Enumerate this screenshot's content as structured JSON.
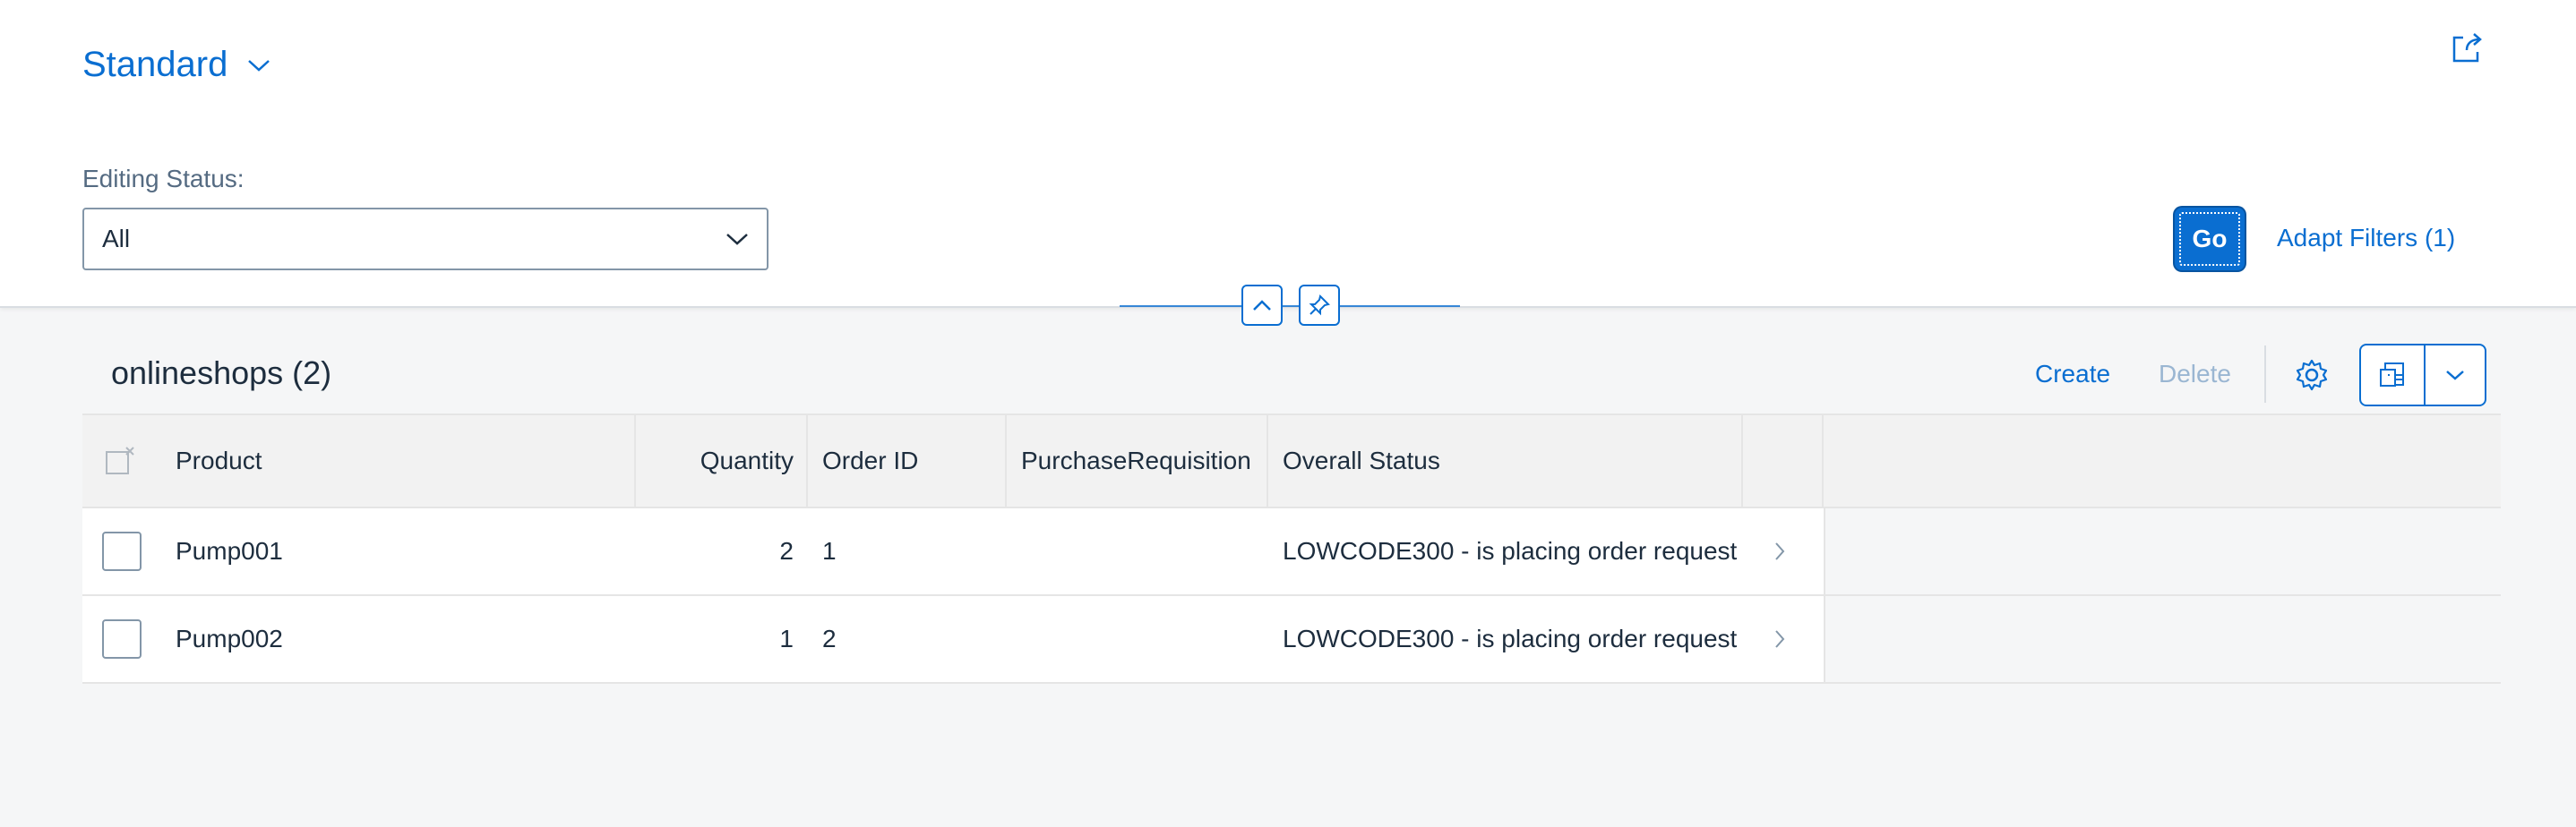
{
  "header": {
    "variant_label": "Standard",
    "filter_label": "Editing Status:",
    "filter_value": "All",
    "go_label": "Go",
    "adapt_label": "Adapt Filters (1)"
  },
  "table": {
    "title": "onlineshops (2)",
    "create_label": "Create",
    "delete_label": "Delete",
    "columns": [
      "Product",
      "Quantity",
      "Order ID",
      "PurchaseRequisition",
      "Overall Status"
    ],
    "rows": [
      {
        "product": "Pump001",
        "quantity": "2",
        "order_id": "1",
        "purchase_requisition": "",
        "overall_status": "LOWCODE300 - is placing order request"
      },
      {
        "product": "Pump002",
        "quantity": "1",
        "order_id": "2",
        "purchase_requisition": "",
        "overall_status": "LOWCODE300 - is placing order request"
      }
    ]
  },
  "colors": {
    "accent": "#0a6ed1",
    "disabled": "#9ab6d2",
    "background": "#f5f6f7"
  },
  "icons": [
    "chevron-down-icon",
    "share-icon",
    "collapse-icon",
    "pin-icon",
    "settings-icon",
    "export-icon",
    "chevron-right-icon",
    "select-all-icon"
  ]
}
